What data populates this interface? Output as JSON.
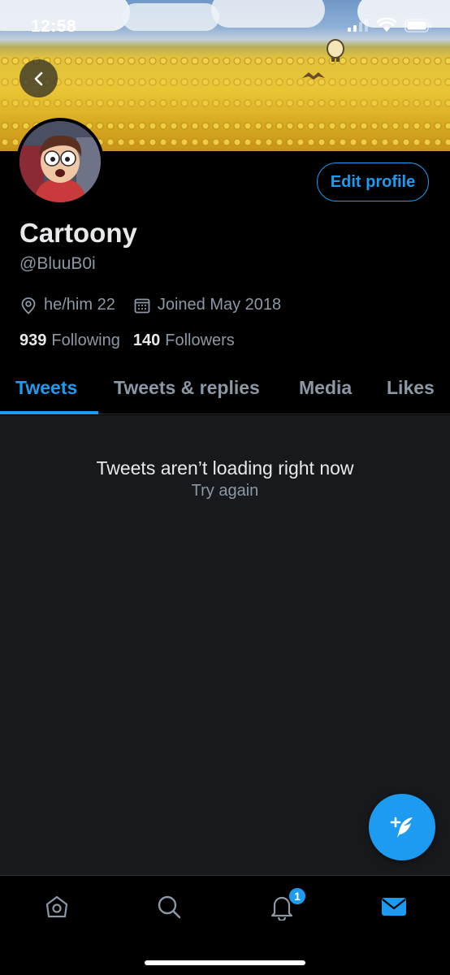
{
  "status_bar": {
    "time": "12:58"
  },
  "profile": {
    "display_name": "Cartoony",
    "handle": "@BluuB0i",
    "bio_location": "he/him 22",
    "joined": "Joined May 2018",
    "following_count": "939",
    "following_label": "Following",
    "followers_count": "140",
    "followers_label": "Followers",
    "edit_button_label": "Edit profile"
  },
  "tabs": [
    {
      "label": "Tweets",
      "active": true
    },
    {
      "label": "Tweets & replies",
      "active": false
    },
    {
      "label": "Media",
      "active": false
    },
    {
      "label": "Likes",
      "active": false
    }
  ],
  "content": {
    "empty_title": "Tweets aren’t loading right now",
    "retry_label": "Try again"
  },
  "tab_bar": {
    "items": [
      "home-icon",
      "search-icon",
      "notifications-icon",
      "messages-icon"
    ],
    "notifications_badge": "1"
  },
  "colors": {
    "accent": "#1d9bf0",
    "background": "#000000",
    "content_bg": "#18191c",
    "muted": "#8b98a5"
  }
}
